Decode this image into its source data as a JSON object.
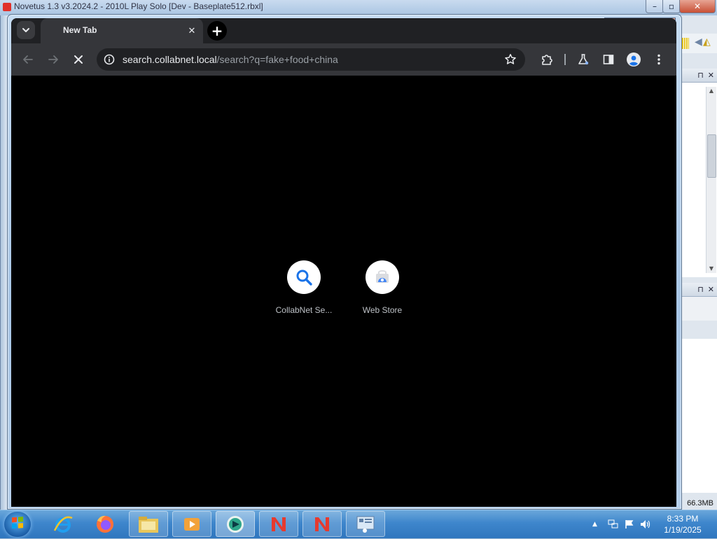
{
  "background_window": {
    "title": "Novetus 1.3 v3.2024.2 - 2010L Play Solo [Dev - Baseplate512.rbxl]",
    "memory": "66.3MB",
    "close_glyph": "✕",
    "min_glyph": "–",
    "max_glyph": "▫",
    "panel_pin": "⊓",
    "panel_close": "✕"
  },
  "browser": {
    "tab": {
      "title": "New Tab",
      "close_glyph": "✕"
    },
    "newtab_glyph": "+",
    "tabsearch_icon": "chevron-down-icon",
    "url_host": "search.collabnet.local",
    "url_rest": "/search?q=fake+food+china",
    "shortcuts": [
      {
        "label": "CollabNet Se...",
        "icon": "search-icon"
      },
      {
        "label": "Web Store",
        "icon": "web-store-icon"
      }
    ],
    "frame_buttons": {
      "min": "▭",
      "max": "▢",
      "close": "✕"
    }
  },
  "taskbar": {
    "apps": [
      "internet-explorer",
      "firefox",
      "file-explorer",
      "media-player",
      "novetus-launcher",
      "novetus-1",
      "novetus-2",
      "studio"
    ],
    "time": "8:33 PM",
    "date": "1/19/2025",
    "tray_chevron": "▲"
  },
  "colors": {
    "accent_blue": "#1a73e8",
    "content_bg": "#000000",
    "toolbar_bg": "#35363a"
  }
}
